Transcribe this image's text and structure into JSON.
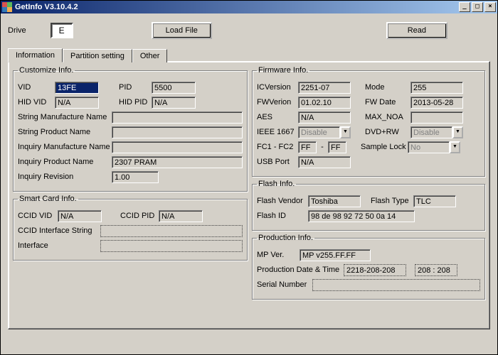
{
  "title": "GetInfo V3.10.4.2",
  "drive_label": "Drive",
  "drive_value": "E",
  "load_file_btn": "Load File",
  "read_btn": "Read",
  "tabs": {
    "information": "Information",
    "partition": "Partition setting",
    "other": "Other"
  },
  "customize": {
    "legend": "Customize Info.",
    "vid_label": "VID",
    "vid": "13FE",
    "pid_label": "PID",
    "pid": "5500",
    "hidvid_label": "HID VID",
    "hidvid": "N/A",
    "hidpid_label": "HID PID",
    "hidpid": "N/A",
    "str_mfg_label": "String Manufacture Name",
    "str_mfg": "",
    "str_prod_label": "String Product Name",
    "str_prod": "",
    "inq_mfg_label": "Inquiry Manufacture Name",
    "inq_mfg": "",
    "inq_prod_label": "Inquiry Product Name",
    "inq_prod": "2307 PRAM",
    "inq_rev_label": "Inquiry Revision",
    "inq_rev": "1.00"
  },
  "smartcard": {
    "legend": "Smart Card Info.",
    "ccid_vid_label": "CCID VID",
    "ccid_vid": "N/A",
    "ccid_pid_label": "CCID PID",
    "ccid_pid": "N/A",
    "ccid_if_label": "CCID Interface String",
    "ccid_if": "",
    "if_label": "Interface",
    "if": ""
  },
  "firmware": {
    "legend": "Firmware Info.",
    "icver_label": "ICVersion",
    "icver": "2251-07",
    "mode_label": "Mode",
    "mode": "255",
    "fwver_label": "FWVerion",
    "fwver": "01.02.10",
    "fwdate_label": "FW Date",
    "fwdate": "2013-05-28",
    "aes_label": "AES",
    "aes": "N/A",
    "maxnoa_label": "MAX_NOA",
    "maxnoa": "",
    "ieee_label": "IEEE 1667",
    "ieee": "Disable",
    "dvdrw_label": "DVD+RW",
    "dvdrw": "Disable",
    "fc_label": "FC1 - FC2",
    "fc1": "FF",
    "fc2": "FF",
    "dash": "-",
    "sample_label": "Sample Lock",
    "sample": "No",
    "usb_label": "USB Port",
    "usb": "N/A"
  },
  "flash": {
    "legend": "Flash Info.",
    "vendor_label": "Flash Vendor",
    "vendor": "Toshiba",
    "type_label": "Flash Type",
    "type": "TLC",
    "id_label": "Flash ID",
    "id": "98 de 98 92 72 50 0a 14"
  },
  "production": {
    "legend": "Production Info.",
    "mpver_label": "MP Ver.",
    "mpver": "MP v255.FF.FF",
    "dt_label": "Production Date & Time",
    "date": "2218-208-208",
    "time": "208 : 208",
    "serial_label": "Serial Number",
    "serial": ""
  }
}
